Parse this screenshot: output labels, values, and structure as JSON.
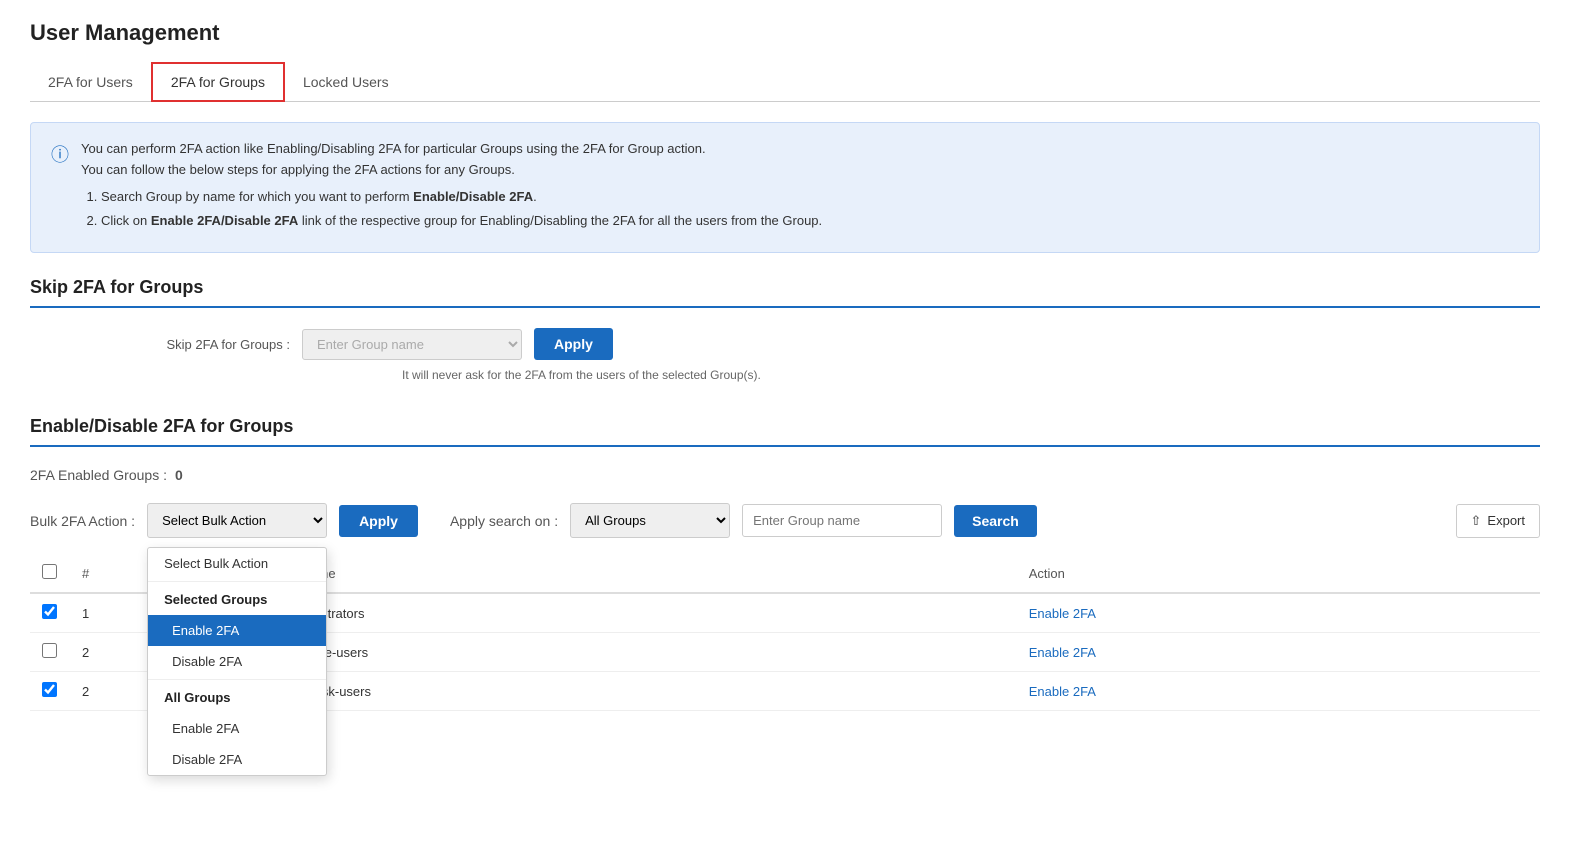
{
  "page": {
    "title": "User Management"
  },
  "tabs": [
    {
      "id": "tab-2fa-users",
      "label": "2FA for Users",
      "active": false
    },
    {
      "id": "tab-2fa-groups",
      "label": "2FA for Groups",
      "active": true
    },
    {
      "id": "tab-locked-users",
      "label": "Locked Users",
      "active": false
    }
  ],
  "infoBox": {
    "line1": "You can perform 2FA action like Enabling/Disabling 2FA for particular Groups using the 2FA for Group action.",
    "line2": "You can follow the below steps for applying the 2FA actions for any Groups.",
    "step1_prefix": "Search Group by name for which you want to perform ",
    "step1_bold": "Enable/Disable 2FA",
    "step1_suffix": ".",
    "step2_prefix": "Click on ",
    "step2_bold": "Enable 2FA/Disable 2FA",
    "step2_suffix": " link of the respective group for Enabling/Disabling the 2FA for all the users from the Group."
  },
  "skip2fa": {
    "sectionTitle": "Skip 2FA for Groups",
    "label": "Skip 2FA for Groups :",
    "placeholder": "Enter Group name",
    "applyLabel": "Apply",
    "hint": "It will never ask for the 2FA from the users of the selected Group(s)."
  },
  "enableDisable": {
    "sectionTitle": "Enable/Disable 2FA for Groups",
    "enabledGroupsLabel": "2FA Enabled Groups :",
    "enabledGroupsValue": "0"
  },
  "bulkAction": {
    "label": "Bulk 2FA Action :",
    "selectPlaceholder": "Select Bulk Action",
    "applyLabel": "Apply",
    "dropdownItems": [
      {
        "type": "item",
        "label": "Select Bulk Action"
      },
      {
        "type": "header",
        "label": "Selected Groups"
      },
      {
        "type": "item-indent",
        "label": "Enable 2FA",
        "highlighted": true
      },
      {
        "type": "item-indent",
        "label": "Disable 2FA"
      },
      {
        "type": "header",
        "label": "All Groups"
      },
      {
        "type": "item-indent",
        "label": "Enable 2FA"
      },
      {
        "type": "item-indent",
        "label": "Disable 2FA"
      }
    ]
  },
  "search": {
    "label": "Apply search on :",
    "selectValue": "All Groups",
    "placeholder": "Enter Group name",
    "buttonLabel": "Search"
  },
  "exportLabel": "Export",
  "table": {
    "columns": [
      {
        "key": "checkbox",
        "label": ""
      },
      {
        "key": "num",
        "label": "#"
      },
      {
        "key": "groupName",
        "label": "Group Name"
      },
      {
        "key": "action",
        "label": "Action"
      }
    ],
    "rows": [
      {
        "checked": true,
        "num": "1",
        "groupName": "jira-administrators",
        "action": "Enable 2FA"
      },
      {
        "checked": false,
        "num": "2",
        "groupName": "jira-software-users",
        "action": "Enable 2FA"
      },
      {
        "checked": true,
        "num": "2",
        "groupName": "jira-helpdesk-users",
        "action": "Enable 2FA"
      }
    ]
  }
}
